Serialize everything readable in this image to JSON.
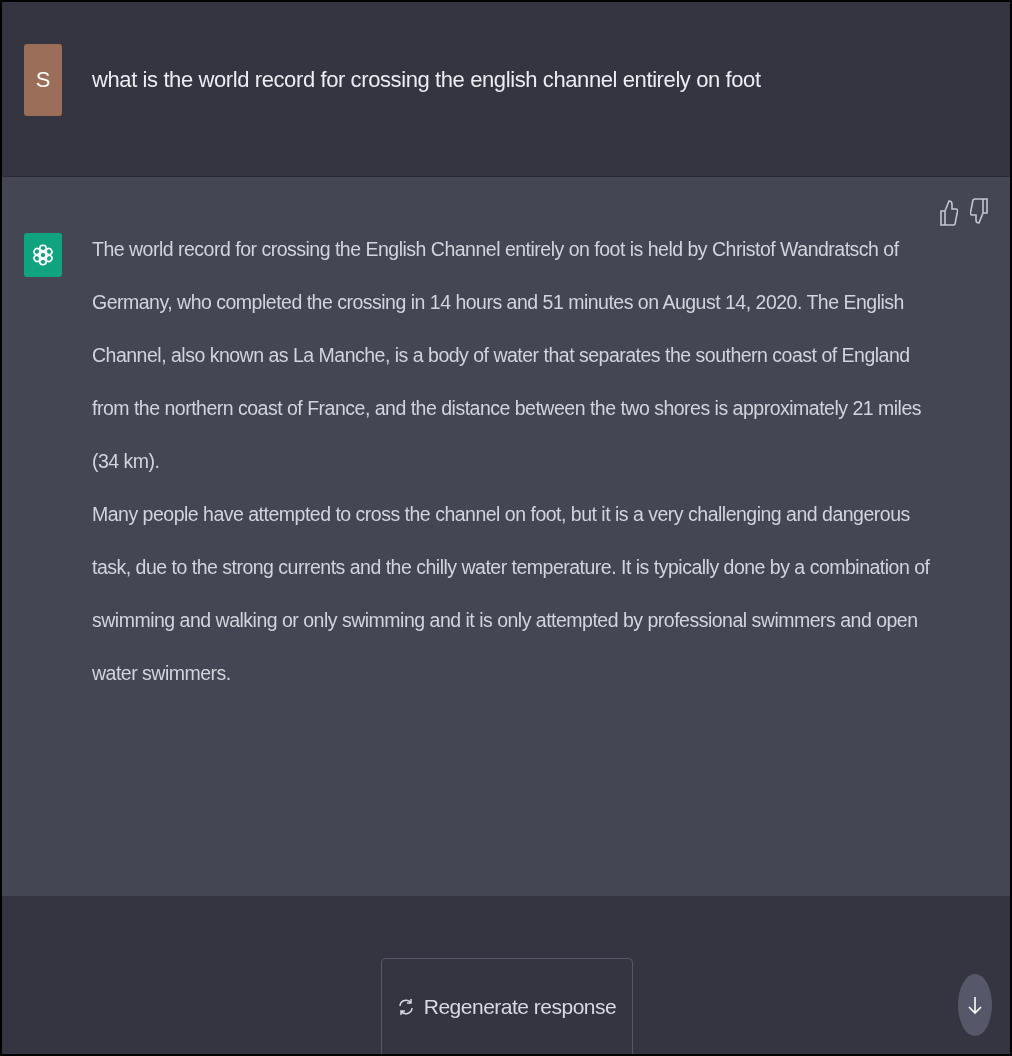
{
  "user_message": {
    "avatar_letter": "S",
    "text": "what is the world record for crossing the english channel entirely on foot"
  },
  "assistant_message": {
    "paragraphs": [
      "The world record for crossing the English Channel entirely on foot is held by Christof Wandratsch of Germany, who completed the crossing in 14 hours and 51 minutes on August 14, 2020. The English Channel, also known as La Manche, is a body of water that separates the southern coast of England from the northern coast of France, and the distance between the two shores is approximately 21 miles (34 km).",
      "Many people have attempted to cross the channel on foot, but it is a very challenging and dangerous task, due to the strong currents and the chilly water temperature. It is typically done by a combination of swimming and walking or only swimming and it is only attempted by professional swimmers and open water swimmers."
    ]
  },
  "regenerate_button": {
    "label": "Regenerate response"
  }
}
